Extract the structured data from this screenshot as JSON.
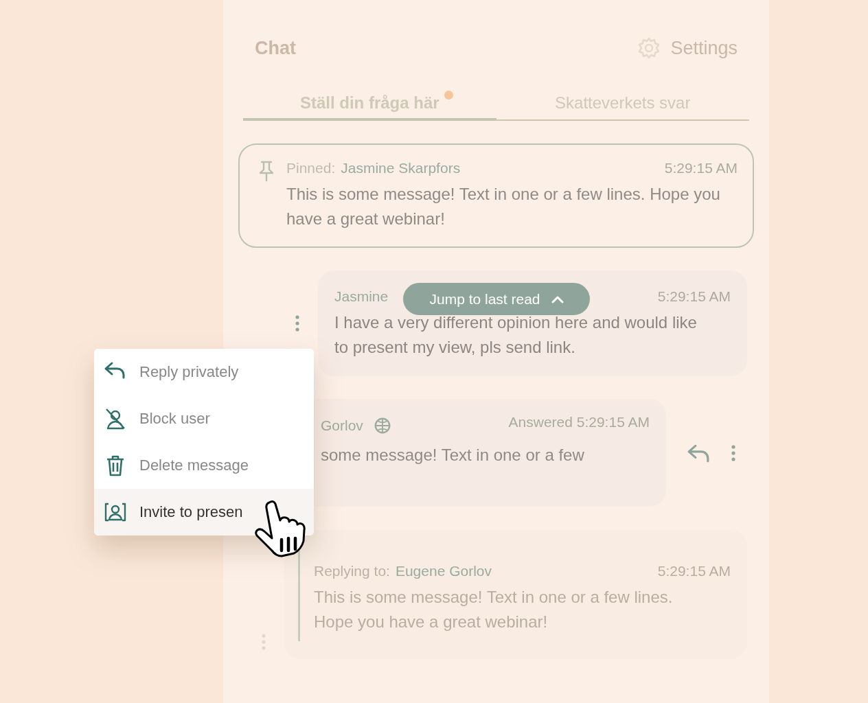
{
  "header": {
    "title": "Chat",
    "settings": "Settings"
  },
  "tabs": [
    {
      "label": "Ställ din fråga här",
      "selected": true,
      "unread": true
    },
    {
      "label": "Skatteverkets svar",
      "selected": false,
      "unread": false
    }
  ],
  "pinned": {
    "prefix": "Pinned:",
    "author": "Jasmine Skarpfors",
    "time": "5:29:15 AM",
    "text": "This is some message! Text in one or a few lines. Hope you have a great webinar!"
  },
  "messages": [
    {
      "kind": "question",
      "author": "Jasmine",
      "time": "5:29:15 AM",
      "text": "I have a very different opinion here and would like to present my view, pls send link."
    },
    {
      "kind": "answered",
      "author": "Gorlov",
      "time": "Answered 5:29:15 AM",
      "text": "some message! Text in one or a few"
    },
    {
      "kind": "reply",
      "prefix": "Replying to:",
      "author": "Eugene Gorlov",
      "time": "5:29:15 AM",
      "text": "This is some message! Text in one or a few lines. Hope you have a great webinar!"
    }
  ],
  "jump_button": {
    "label": "Jump to last read"
  },
  "context_menu": [
    {
      "kind": "reply",
      "label": "Reply privately",
      "hovered": false
    },
    {
      "kind": "block",
      "label": "Block user",
      "hovered": false
    },
    {
      "kind": "trash",
      "label": "Delete message",
      "hovered": false
    },
    {
      "kind": "present",
      "label": "Invite to presen",
      "hovered": true
    }
  ]
}
